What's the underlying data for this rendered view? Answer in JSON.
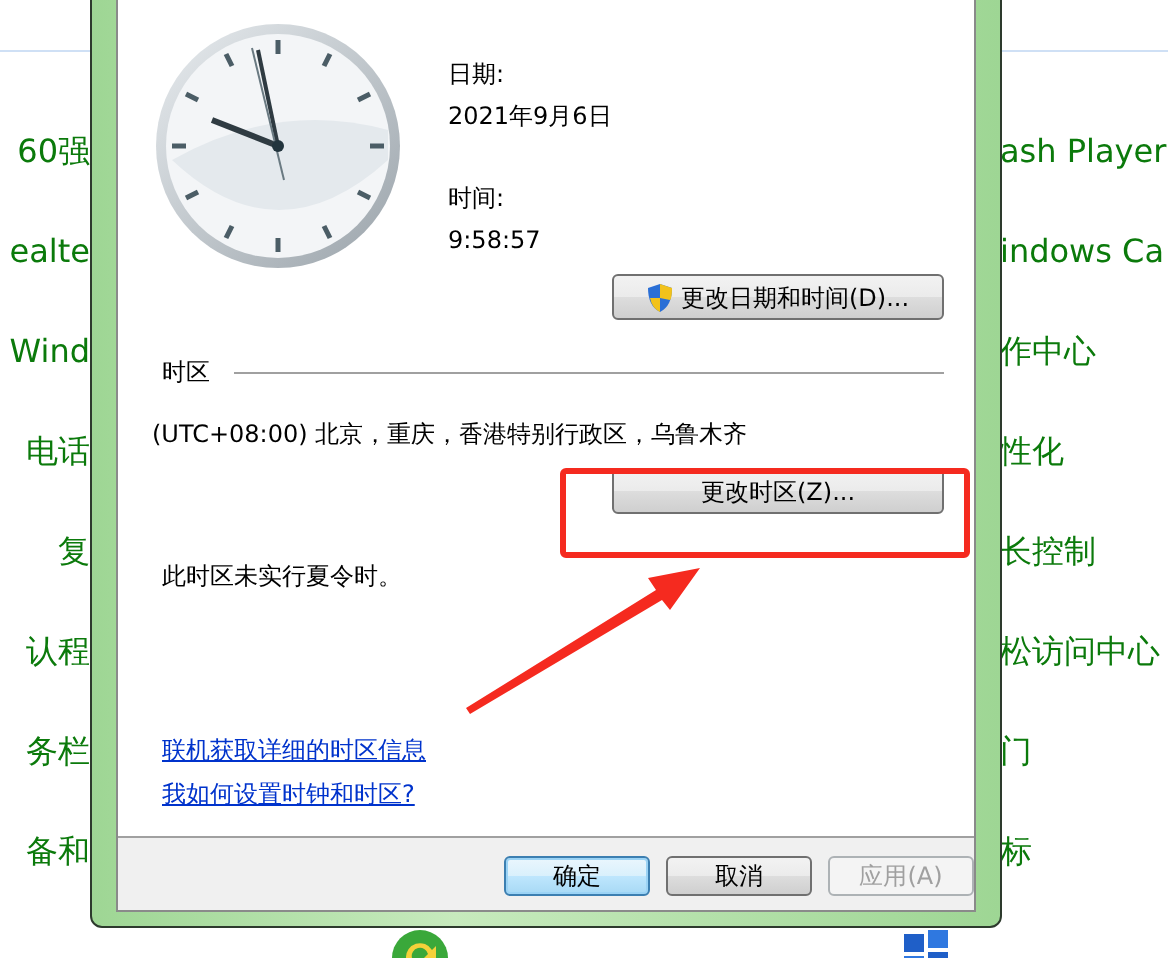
{
  "background": {
    "left_items": [
      "60强",
      "ealte",
      "Wind",
      "电话",
      "复",
      "认程",
      "务栏",
      "备和"
    ],
    "right_items": [
      "ash Player",
      "indows Ca",
      "作中心",
      "性化",
      "长控制",
      "松访问中心",
      "门",
      "标"
    ]
  },
  "dialog": {
    "date_label": "日期:",
    "date": "2021年9月6日",
    "time_label": "时间:",
    "time": "9:58:57",
    "change_datetime_button": "更改日期和时间(D)...",
    "timezone_section": "时区",
    "timezone": "(UTC+08:00) 北京，重庆，香港特别行政区，乌鲁木齐",
    "change_timezone_button": "更改时区(Z)...",
    "dst_note": "此时区未实行夏令时。",
    "links": [
      "联机获取详细的时区信息",
      "我如何设置时钟和时区?"
    ],
    "buttons": [
      {
        "label": "确定",
        "kind": "default",
        "disabled": false
      },
      {
        "label": "取消",
        "kind": "normal",
        "disabled": false
      },
      {
        "label": "应用(A)",
        "kind": "normal",
        "disabled": true
      }
    ]
  }
}
